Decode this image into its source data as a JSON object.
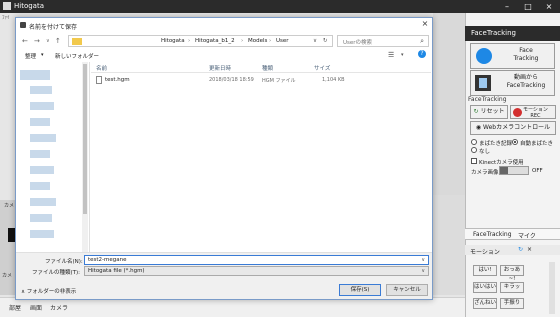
{
  "app": {
    "title": "Hitogata",
    "menu_hint": "ﾌｧｲ"
  },
  "dialog": {
    "title": "名前を付けて保存",
    "nav": {
      "back": "←",
      "forward": "→",
      "up": "↑"
    },
    "breadcrumbs": [
      "Hitogata",
      "Hitogata_b1_2",
      "Models",
      "User"
    ],
    "search_placeholder": "Userの検索",
    "toolbar": {
      "organize": "整理",
      "new_folder": "新しいフォルダー",
      "help": "?"
    },
    "columns": {
      "name": "名前",
      "modified": "更新日時",
      "type": "種類",
      "size": "サイズ"
    },
    "files": [
      {
        "name": "test.hgm",
        "modified": "2018/03/18 18:59",
        "type": "HGM ファイル",
        "size": "1,104 KB"
      }
    ],
    "filename_label": "ファイル名(N):",
    "filename_value": "test2-megane",
    "filetype_label": "ファイルの種類(T):",
    "filetype_value": "Hitogata file (*.hgm)",
    "hide_folders": "フォルダーの非表示",
    "save_button": "保存(S)",
    "cancel_button": "キャンセル"
  },
  "left_panel": {
    "label_top": "カメ",
    "label_bottom": "カメ"
  },
  "bottom_tabs": [
    "部屋",
    "画面",
    "カメラ"
  ],
  "face_tracking": {
    "header": "FaceTracking",
    "face_tracking_button": "Face\nTracking",
    "video_button": "動画から\nFaceTracking",
    "section_label": "FaceTracking",
    "reset_button": "リセット",
    "motion_rec_button": "モーション\nREC",
    "webcam_button": "Webカメラコントロール",
    "blink_option": "まばたき記録",
    "auto_blink_option": "自動まばたき",
    "none_option": "なし",
    "kinect_checkbox": "Kinectカメラ使用",
    "camera_image_label": "カメラ画像",
    "camera_toggle": "OFF",
    "tabs": [
      "FaceTracking",
      "マイク"
    ],
    "motion_header": "モーション",
    "motion_buttons": [
      "はい!",
      "おっあ~!",
      "はいはい",
      "キラッ",
      "ざんねい",
      "手振り"
    ]
  },
  "colors": {
    "accent": "#1e88e5",
    "record": "#d32f2f",
    "titlebar": "#2b2b2b"
  }
}
